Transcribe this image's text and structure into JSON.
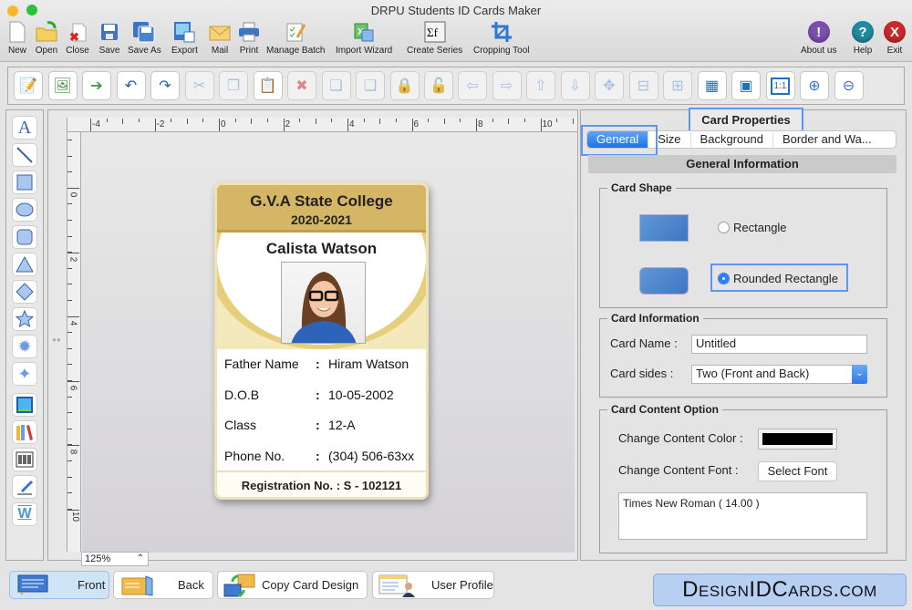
{
  "window": {
    "title": "DRPU Students ID Cards Maker"
  },
  "main_toolbar": [
    {
      "label": "New",
      "icon": "new-document-icon"
    },
    {
      "label": "Open",
      "icon": "open-folder-icon"
    },
    {
      "label": "Close",
      "icon": "close-document-icon"
    },
    {
      "label": "Save",
      "icon": "save-icon"
    },
    {
      "label": "Save As",
      "icon": "save-as-icon"
    },
    {
      "label": "Export",
      "icon": "export-icon"
    },
    {
      "label": "Mail",
      "icon": "mail-icon"
    },
    {
      "label": "Print",
      "icon": "print-icon"
    },
    {
      "label": "Manage Batch",
      "icon": "manage-batch-icon"
    },
    {
      "label": "Import Wizard",
      "icon": "import-wizard-icon"
    },
    {
      "label": "Create Series",
      "icon": "create-series-icon"
    },
    {
      "label": "Cropping Tool",
      "icon": "crop-icon"
    }
  ],
  "right_toolbar": [
    {
      "label": "About us",
      "icon": "about-icon",
      "glyph": "!",
      "color": "#7b4fb0"
    },
    {
      "label": "Help",
      "icon": "help-icon",
      "glyph": "?",
      "color": "#1f8aa0"
    },
    {
      "label": "Exit",
      "icon": "exit-icon",
      "glyph": "X",
      "color": "#cc2a2a"
    }
  ],
  "edit_toolbar": {
    "glyphs": [
      "📝",
      "🖼",
      "➔",
      "↶",
      "↷",
      "✂",
      "❐",
      "📋",
      "✖",
      "❏",
      "❏",
      "🔒",
      "🔓",
      "⇦",
      "⇨",
      "⇧",
      "⇩",
      "✥",
      "⊟",
      "⊞",
      "▦",
      "▣",
      "1:1",
      "⊕",
      "⊖"
    ]
  },
  "canvas": {
    "zoom": "125%",
    "ruler_h_labels": [
      "-4",
      "-2",
      "0",
      "2",
      "4",
      "6",
      "8",
      "10"
    ],
    "ruler_v_labels": [
      "0",
      "2",
      "4",
      "6",
      "8",
      "10"
    ]
  },
  "card": {
    "college": "G.V.A State College",
    "session": "2020-2021",
    "student_name": "Calista Watson",
    "fields": [
      {
        "label": "Father Name",
        "sep": ":",
        "value": "Hiram Watson"
      },
      {
        "label": "D.O.B",
        "sep": ":",
        "value": "10-05-2002"
      },
      {
        "label": "Class",
        "sep": ":",
        "value": "12-A"
      },
      {
        "label": "Phone No.",
        "sep": ":",
        "value": "(304) 506-63xx"
      }
    ],
    "registration": "Registration No. :  S - 102121"
  },
  "properties": {
    "title": "Card Properties",
    "tabs": [
      "General",
      "Size",
      "Background",
      "Border and Wa..."
    ],
    "section_title": "General Information",
    "card_shape": {
      "legend": "Card Shape",
      "options": [
        "Rectangle",
        "Rounded Rectangle"
      ],
      "selected": "Rounded Rectangle"
    },
    "card_info": {
      "legend": "Card Information",
      "name_label": "Card Name :",
      "name_value": "Untitled",
      "sides_label": "Card sides :",
      "sides_value": "Two (Front and Back)"
    },
    "content_option": {
      "legend": "Card Content Option",
      "color_label": "Change Content Color :",
      "color_value": "#000000",
      "font_label": "Change Content Font :",
      "font_button": "Select Font",
      "font_value": "Times New Roman ( 14.00 )"
    }
  },
  "bottom": {
    "front": "Front",
    "back": "Back",
    "copy": "Copy Card Design",
    "profile": "User Profile"
  },
  "brand": "DesignIDCards.com"
}
